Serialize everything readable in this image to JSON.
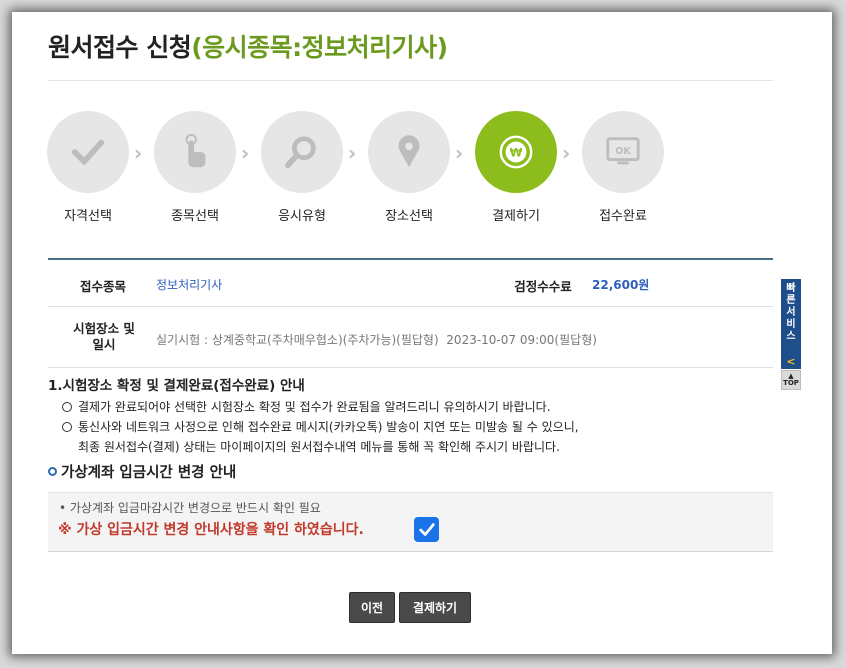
{
  "title": {
    "main": "원서접수 신청",
    "subject": "(응시종목:정보처리기사)"
  },
  "steps": [
    {
      "label": "자격선택",
      "icon": "check-icon",
      "active": false
    },
    {
      "label": "종목선택",
      "icon": "hand-pointer-icon",
      "active": false
    },
    {
      "label": "응시유형",
      "icon": "magnifier-icon",
      "active": false
    },
    {
      "label": "장소선택",
      "icon": "map-pin-icon",
      "active": false
    },
    {
      "label": "결제하기",
      "icon": "won-coin-icon",
      "active": true
    },
    {
      "label": "접수완료",
      "icon": "ok-monitor-icon",
      "active": false
    }
  ],
  "info": {
    "subject_label": "접수종목",
    "subject_value": "정보처리기사",
    "fee_label": "검정수수료",
    "fee_value": "22,600원",
    "place_label_1": "시험장소 및",
    "place_label_2": "일시",
    "place_value": "실기시험 : 상계중학교(주차매우협소)(주차가능)(필답형)",
    "datetime_value": "2023-10-07 09:00(필답형)"
  },
  "notice": {
    "heading": "1.시험장소 확정 및 결제완료(접수완료) 안내",
    "item1": "결제가 완료되어야 선택한 시험장소 확정 및 접수가 완료됨을 알려드리니 유의하시기 바랍니다.",
    "item2": "통신사와 네트워크 사정으로 인해 접수완료 메시지(카카오톡) 발송이 지연 또는 미발송 될 수 있으니,",
    "item2_cont": "최종 원서접수(결제) 상태는 마이페이지의 원서접수내역 메뉴를 통해 꼭 확인해 주시기 바랍니다."
  },
  "virtual_account": {
    "heading": "가상계좌 입금시간 변경 안내",
    "line1": "• 가상계좌 입금마감시간 변경으로 반드시 확인 필요",
    "confirm_text": "※ 가상 입금시간 변경 안내사항을 확인 하였습니다.",
    "checked": true
  },
  "buttons": {
    "prev": "이전",
    "pay": "결제하기"
  },
  "side": {
    "quick_chars": [
      "빠",
      "른",
      "서",
      "비",
      "스"
    ],
    "toggle": "<",
    "top": "TOP"
  },
  "colors": {
    "active_step": "#8dbd1c",
    "subject_green": "#6b9a1f",
    "link_blue": "#2d5fbf",
    "warning_red": "#c0392b",
    "checkbox_blue": "#1a73e8"
  }
}
